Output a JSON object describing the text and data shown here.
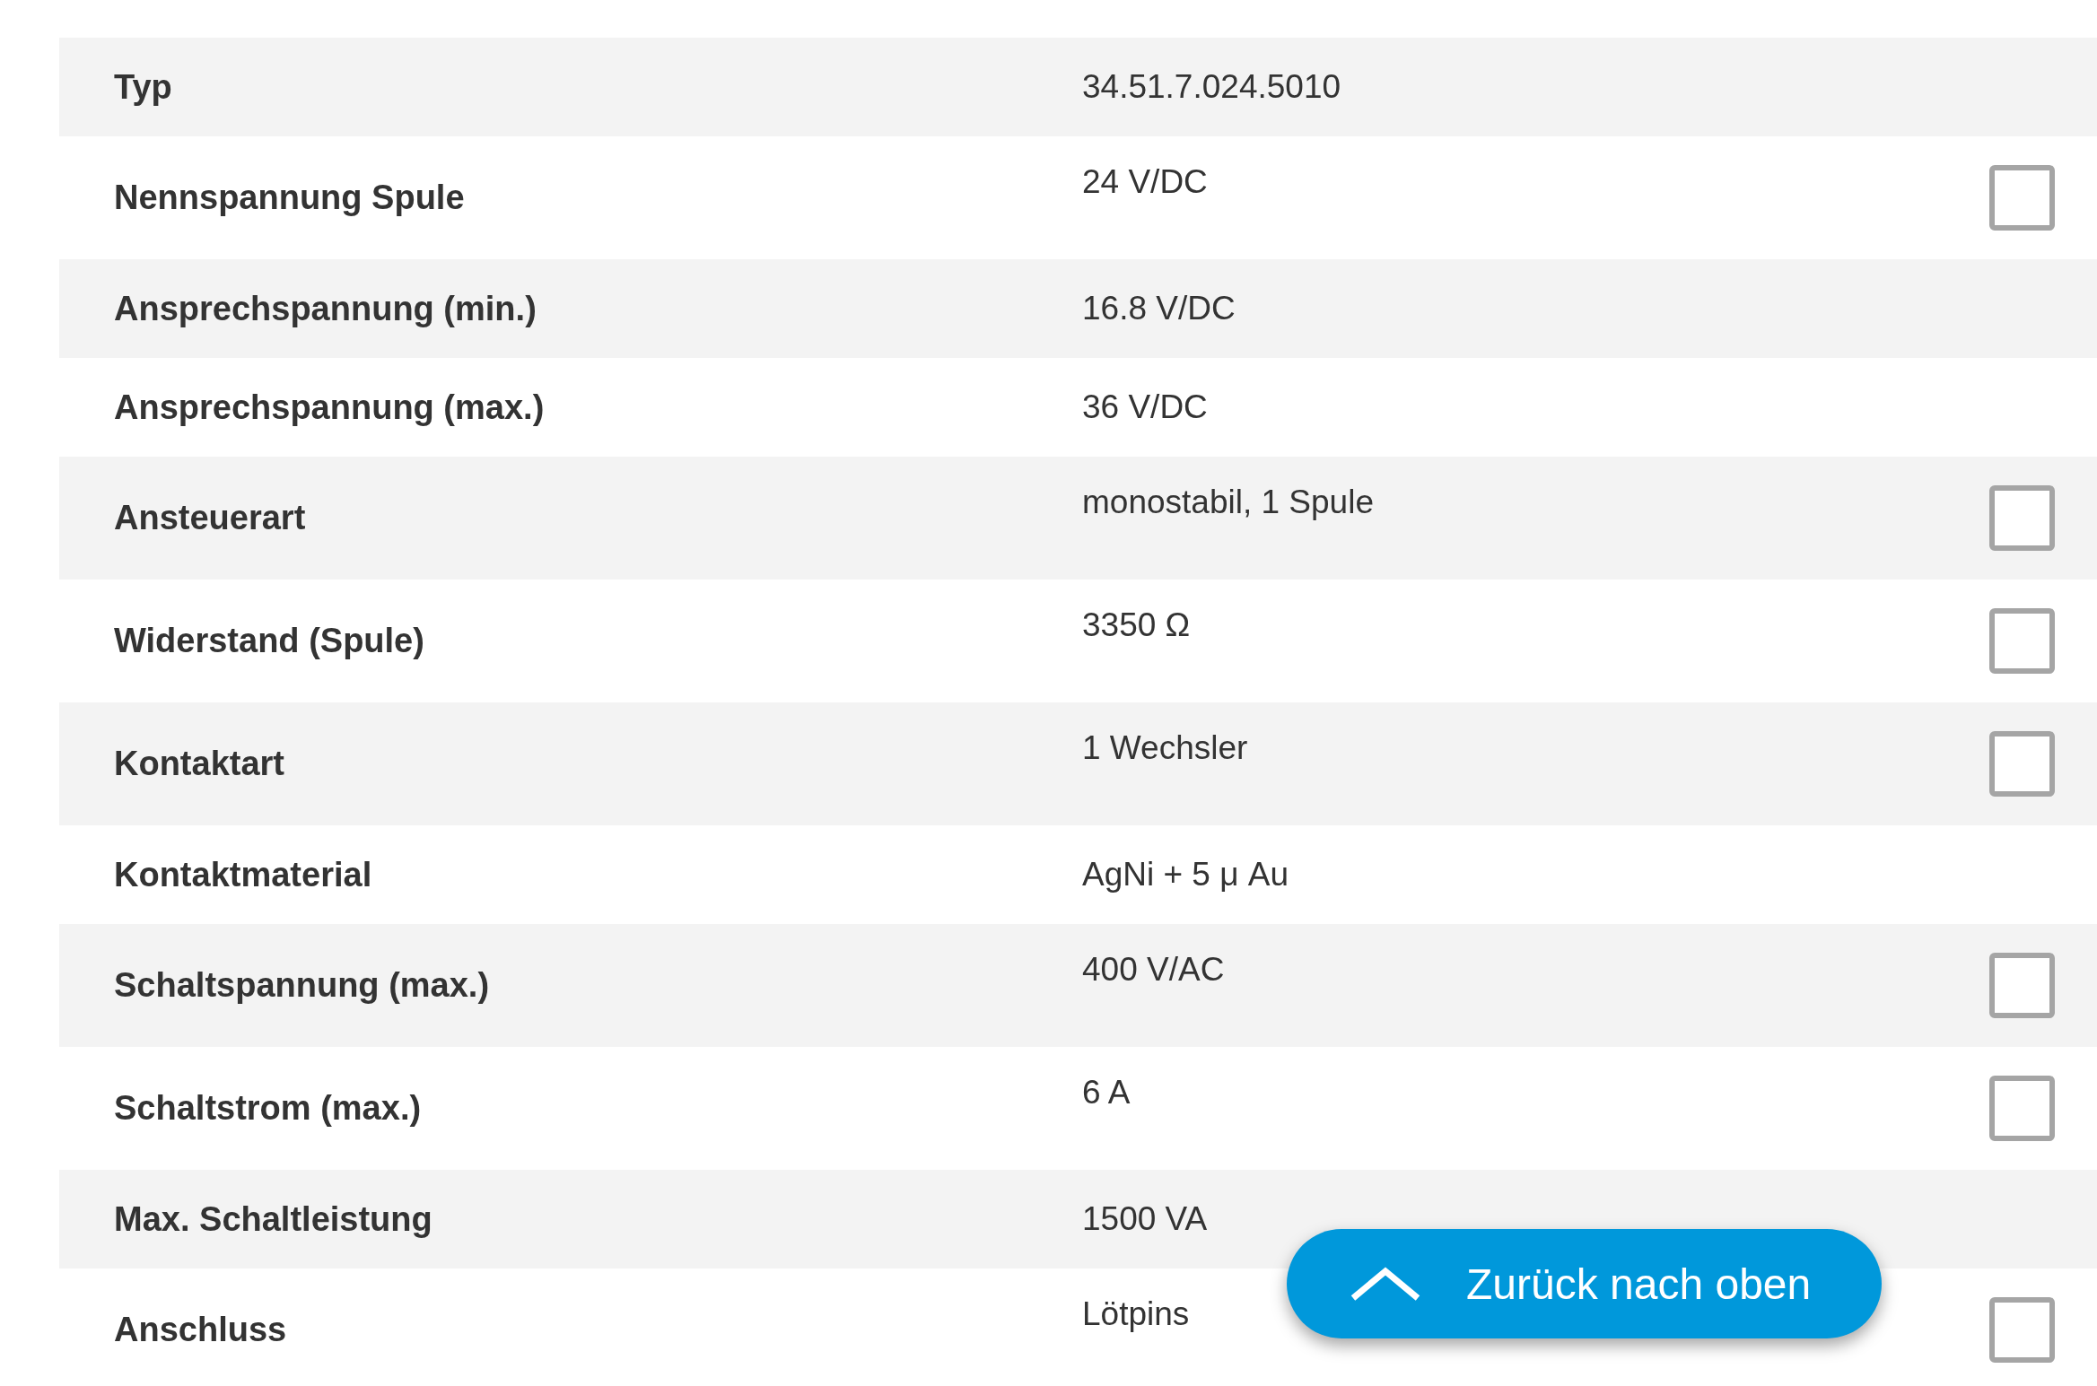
{
  "rows": [
    {
      "label": "Typ",
      "value": "34.51.7.024.5010",
      "kind": "plain"
    },
    {
      "label": "Nennspannung Spule",
      "value": "24 V/DC",
      "kind": "compare",
      "checked": false
    },
    {
      "label": "Ansprechspannung (min.)",
      "value": "16.8 V/DC",
      "kind": "plain"
    },
    {
      "label": "Ansprechspannung (max.)",
      "value": "36 V/DC",
      "kind": "plain"
    },
    {
      "label": "Ansteuerart",
      "value": "monostabil, 1 Spule",
      "kind": "compare",
      "checked": false
    },
    {
      "label": "Widerstand (Spule)",
      "value": "3350 Ω",
      "kind": "compare",
      "checked": false
    },
    {
      "label": "Kontaktart",
      "value": "1 Wechsler",
      "kind": "compare",
      "checked": false
    },
    {
      "label": "Kontaktmaterial",
      "value": "AgNi + 5 μ Au",
      "kind": "plain"
    },
    {
      "label": "Schaltspannung (max.)",
      "value": "400 V/AC",
      "kind": "compare",
      "checked": false
    },
    {
      "label": "Schaltstrom (max.)",
      "value": "6 A",
      "kind": "compare",
      "checked": false
    },
    {
      "label": "Max. Schaltleistung",
      "value": "1500 VA",
      "kind": "plain"
    },
    {
      "label": "Anschluss",
      "value": "Lötpins",
      "kind": "compare",
      "checked": false
    }
  ],
  "back_to_top": {
    "label": "Zurück nach oben"
  }
}
